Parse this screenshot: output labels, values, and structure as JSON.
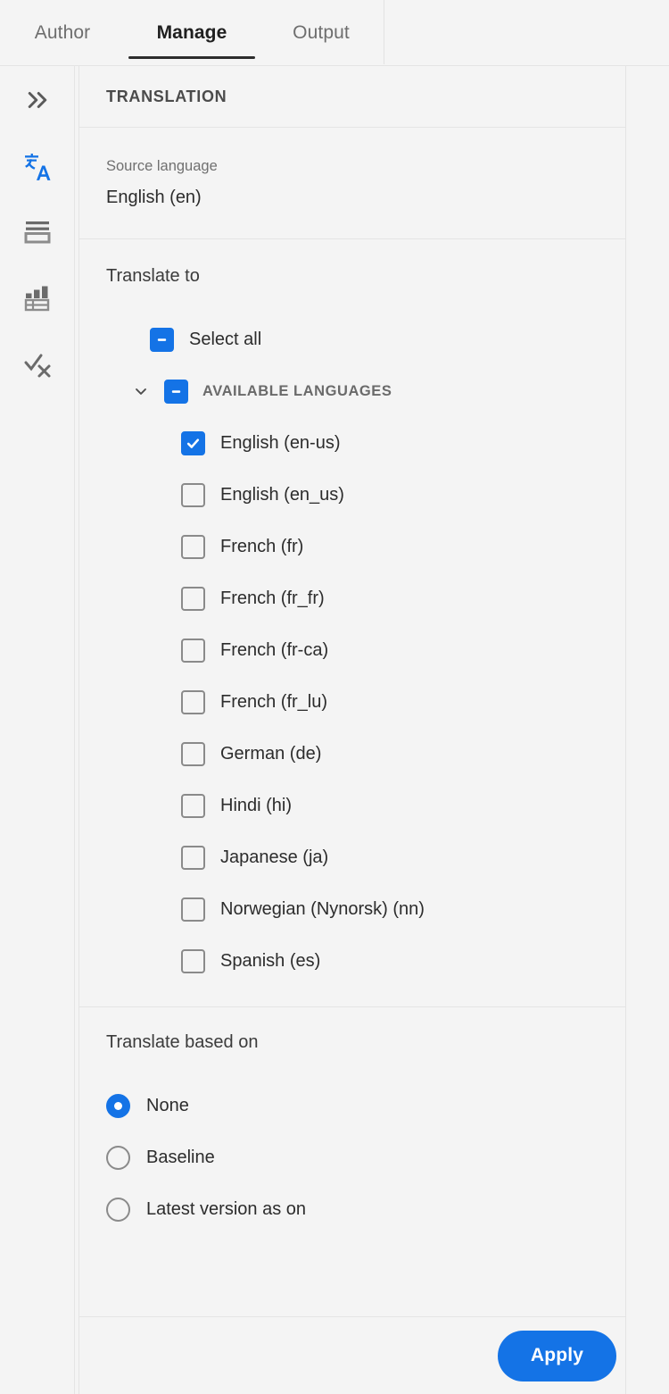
{
  "tabs": [
    {
      "label": "Author",
      "active": false
    },
    {
      "label": "Manage",
      "active": true
    },
    {
      "label": "Output",
      "active": false
    }
  ],
  "rail": {
    "items": [
      {
        "name": "expand-panel-icon",
        "title": "Expand"
      },
      {
        "name": "translate-icon",
        "title": "Translation"
      },
      {
        "name": "list-icon",
        "title": "Conditions"
      },
      {
        "name": "report-icon",
        "title": "Reports"
      },
      {
        "name": "check-x-icon",
        "title": "Review"
      }
    ]
  },
  "panel": {
    "title": "TRANSLATION",
    "source": {
      "label": "Source language",
      "value": "English (en)"
    },
    "translate_to": {
      "title": "Translate to",
      "select_all": {
        "label": "Select all",
        "state": "indeterminate"
      },
      "group": {
        "label": "AVAILABLE LANGUAGES",
        "state": "indeterminate",
        "expanded": true
      },
      "languages": [
        {
          "label": "English (en-us)",
          "checked": true
        },
        {
          "label": "English (en_us)",
          "checked": false
        },
        {
          "label": "French (fr)",
          "checked": false
        },
        {
          "label": "French (fr_fr)",
          "checked": false
        },
        {
          "label": "French (fr-ca)",
          "checked": false
        },
        {
          "label": "French (fr_lu)",
          "checked": false
        },
        {
          "label": "German (de)",
          "checked": false
        },
        {
          "label": "Hindi (hi)",
          "checked": false
        },
        {
          "label": "Japanese (ja)",
          "checked": false
        },
        {
          "label": "Norwegian (Nynorsk) (nn)",
          "checked": false
        },
        {
          "label": "Spanish (es)",
          "checked": false
        }
      ]
    },
    "translate_based_on": {
      "title": "Translate based on",
      "options": [
        {
          "label": "None",
          "selected": true
        },
        {
          "label": "Baseline",
          "selected": false
        },
        {
          "label": "Latest version as on",
          "selected": false
        }
      ]
    },
    "footer": {
      "apply_label": "Apply"
    }
  },
  "colors": {
    "accent": "#1473e6",
    "background": "#f4f4f4",
    "divider": "#e4e4e4",
    "text": "#2c2c2c",
    "muted": "#707070"
  }
}
